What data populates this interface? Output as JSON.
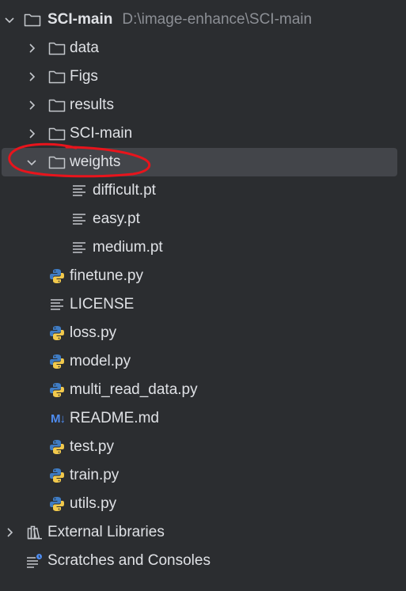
{
  "tree": {
    "root": {
      "label": "SCI-main",
      "path": "D:\\image-enhance\\SCI-main",
      "icon": "folder-icon",
      "expanded": true
    },
    "folders": [
      {
        "label": "data",
        "icon": "folder-icon",
        "expanded": false
      },
      {
        "label": "Figs",
        "icon": "folder-icon",
        "expanded": false
      },
      {
        "label": "results",
        "icon": "folder-icon",
        "expanded": false
      },
      {
        "label": "SCI-main",
        "icon": "folder-icon",
        "expanded": false
      },
      {
        "label": "weights",
        "icon": "folder-icon",
        "expanded": true,
        "selected": true
      }
    ],
    "weights_files": [
      {
        "label": "difficult.pt",
        "icon": "text-file-icon"
      },
      {
        "label": "easy.pt",
        "icon": "text-file-icon"
      },
      {
        "label": "medium.pt",
        "icon": "text-file-icon"
      }
    ],
    "files": [
      {
        "label": "finetune.py",
        "icon": "python-file-icon"
      },
      {
        "label": "LICENSE",
        "icon": "text-file-icon"
      },
      {
        "label": "loss.py",
        "icon": "python-file-icon"
      },
      {
        "label": "model.py",
        "icon": "python-file-icon"
      },
      {
        "label": "multi_read_data.py",
        "icon": "python-file-icon"
      },
      {
        "label": "README.md",
        "icon": "markdown-file-icon",
        "icon_text": "M↓"
      },
      {
        "label": "test.py",
        "icon": "python-file-icon"
      },
      {
        "label": "train.py",
        "icon": "python-file-icon"
      },
      {
        "label": "utils.py",
        "icon": "python-file-icon"
      }
    ],
    "bottom": [
      {
        "label": "External Libraries",
        "icon": "library-icon",
        "expanded": false
      },
      {
        "label": "Scratches and Consoles",
        "icon": "scratches-icon"
      }
    ]
  },
  "colors": {
    "background": "#2b2d30",
    "selection": "#43454a",
    "text": "#dfe1e5",
    "path_text": "#8c8f95",
    "annotation": "#e8141c",
    "python_blue": "#3f7cc4",
    "python_yellow": "#f2c94c",
    "markdown": "#4e8cf0"
  }
}
